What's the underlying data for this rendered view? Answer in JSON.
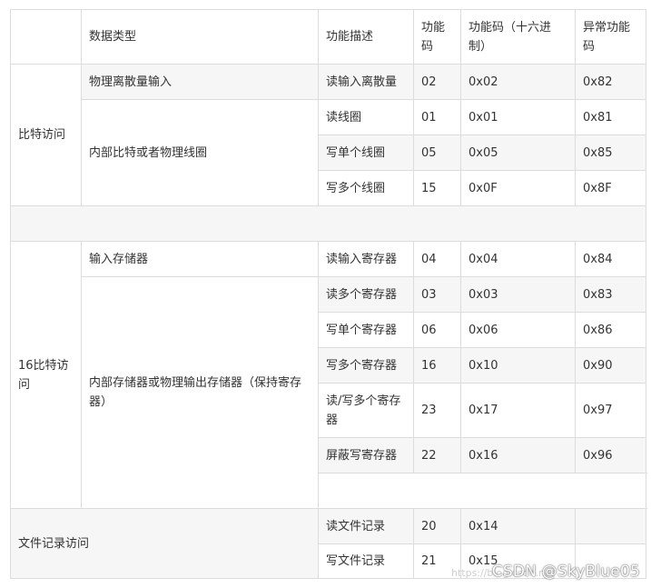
{
  "header": {
    "c0": "",
    "c1": "数据类型",
    "c2": "功能描述",
    "c3": "功能码",
    "c4": "功能码（十六进制）",
    "c5": "异常功能码"
  },
  "groups": {
    "bit": "比特访问",
    "reg": "16比特访问",
    "file": "文件记录访问"
  },
  "types": {
    "discrete": "物理离散量输入",
    "coils": "内部比特或者物理线圈",
    "input_reg": "输入存储器",
    "holding": "内部存储器或物理输出存储器（保持寄存器）"
  },
  "rows": [
    {
      "desc": "读输入离散量",
      "code": "02",
      "hex": "0x02",
      "exc": "0x82"
    },
    {
      "desc": "读线圈",
      "code": "01",
      "hex": "0x01",
      "exc": "0x81"
    },
    {
      "desc": "写单个线圈",
      "code": "05",
      "hex": "0x05",
      "exc": "0x85"
    },
    {
      "desc": "写多个线圈",
      "code": "15",
      "hex": "0x0F",
      "exc": "0x8F"
    },
    {
      "desc": "读输入寄存器",
      "code": "04",
      "hex": "0x04",
      "exc": "0x84"
    },
    {
      "desc": "读多个寄存器",
      "code": "03",
      "hex": "0x03",
      "exc": "0x83"
    },
    {
      "desc": "写单个寄存器",
      "code": "06",
      "hex": "0x06",
      "exc": "0x86"
    },
    {
      "desc": "写多个寄存器",
      "code": "16",
      "hex": "0x10",
      "exc": "0x90"
    },
    {
      "desc": "读/写多个寄存器",
      "code": "23",
      "hex": "0x17",
      "exc": "0x97"
    },
    {
      "desc": "屏蔽写寄存器",
      "code": "22",
      "hex": "0x16",
      "exc": "0x96"
    },
    {
      "desc": "读文件记录",
      "code": "20",
      "hex": "0x14",
      "exc": ""
    },
    {
      "desc": "写文件记录",
      "code": "21",
      "hex": "0x15",
      "exc": ""
    }
  ],
  "watermark": {
    "url": "https://blog.csdn.net",
    "text": "CSDN @SkyBlue05"
  }
}
